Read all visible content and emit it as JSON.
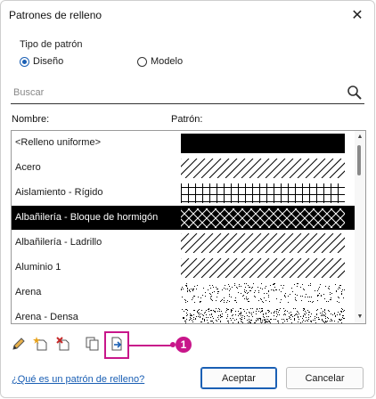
{
  "window": {
    "title": "Patrones de relleno",
    "close_glyph": "✕"
  },
  "pattern_type": {
    "label": "Tipo de patrón",
    "options": [
      {
        "label": "Diseño",
        "checked": true
      },
      {
        "label": "Modelo",
        "checked": false
      }
    ]
  },
  "search": {
    "placeholder": "Buscar",
    "value": "",
    "icon": "search-icon"
  },
  "columns": {
    "name": "Nombre:",
    "pattern": "Patrón:"
  },
  "patterns": [
    {
      "name": "<Relleno uniforme>",
      "pattern": "solid",
      "selected": false
    },
    {
      "name": "Acero",
      "pattern": "diagonal",
      "selected": false
    },
    {
      "name": "Aislamiento - Rígido",
      "pattern": "grid",
      "selected": false
    },
    {
      "name": "Albañilería - Bloque de hormigón",
      "pattern": "crosshatch",
      "selected": true
    },
    {
      "name": "Albañilería - Ladrillo",
      "pattern": "diagonal",
      "selected": false
    },
    {
      "name": "Aluminio 1",
      "pattern": "diagonal",
      "selected": false
    },
    {
      "name": "Arena",
      "pattern": "sand",
      "selected": false
    },
    {
      "name": "Arena - Densa",
      "pattern": "sand-dense",
      "selected": false
    }
  ],
  "toolbar": {
    "buttons": [
      {
        "name": "edit-pattern-button",
        "icon": "pencil-icon"
      },
      {
        "name": "new-pattern-button",
        "icon": "new-pattern-icon"
      },
      {
        "name": "delete-pattern-button",
        "icon": "delete-pattern-icon"
      },
      {
        "name": "duplicate-pattern-button",
        "icon": "duplicate-icon"
      },
      {
        "name": "import-pattern-button",
        "icon": "import-icon"
      }
    ],
    "callout_number": "1",
    "highlight_color": "#c8168a"
  },
  "footer": {
    "help_link": "¿Qué es un patrón de relleno?",
    "ok_label": "Aceptar",
    "cancel_label": "Cancelar"
  },
  "colors": {
    "accent": "#1a5fb4",
    "selection": "#000000",
    "callout": "#c8168a"
  }
}
